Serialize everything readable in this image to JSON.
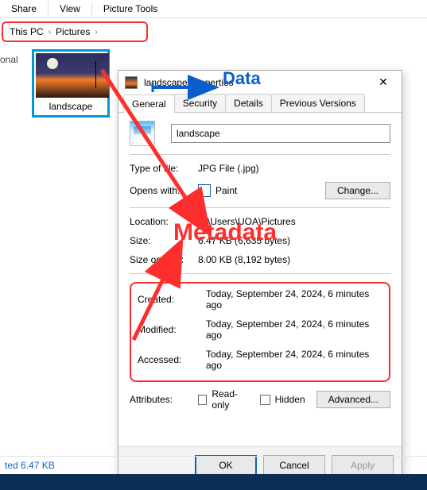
{
  "menu": {
    "share": "Share",
    "view": "View",
    "picture_tools": "Picture Tools"
  },
  "breadcrumb": {
    "root": "This PC",
    "folder": "Pictures"
  },
  "nav": {
    "item": "onal"
  },
  "thumbnail": {
    "caption": "landscape"
  },
  "status": {
    "size": "ted  6.47 KB"
  },
  "dialog": {
    "title": "landscape Properties",
    "tabs": {
      "general": "General",
      "security": "Security",
      "details": "Details",
      "prev": "Previous Versions"
    },
    "name": "landscape",
    "rows": {
      "type_lbl": "Type of file:",
      "type_val": "JPG File (.jpg)",
      "opens_lbl": "Opens with:",
      "opens_val": "Paint",
      "change": "Change...",
      "loc_lbl": "Location:",
      "loc_val": "C:\\Users\\UOA\\Pictures",
      "size_lbl": "Size:",
      "size_val": "6.47 KB (6,635 bytes)",
      "disk_lbl": "Size on disk:",
      "disk_val": "8.00 KB (8,192 bytes)",
      "created_lbl": "Created:",
      "created_val": "Today, September 24, 2024, 6 minutes ago",
      "modified_lbl": "Modified:",
      "modified_val": "Today, September 24, 2024, 6 minutes ago",
      "accessed_lbl": "Accessed:",
      "accessed_val": "Today, September 24, 2024, 6 minutes ago",
      "attr_lbl": "Attributes:",
      "readonly": "Read-only",
      "hidden": "Hidden",
      "advanced": "Advanced..."
    },
    "buttons": {
      "ok": "OK",
      "cancel": "Cancel",
      "apply": "Apply"
    }
  },
  "annotations": {
    "data": "Data",
    "metadata": "Metadata"
  }
}
